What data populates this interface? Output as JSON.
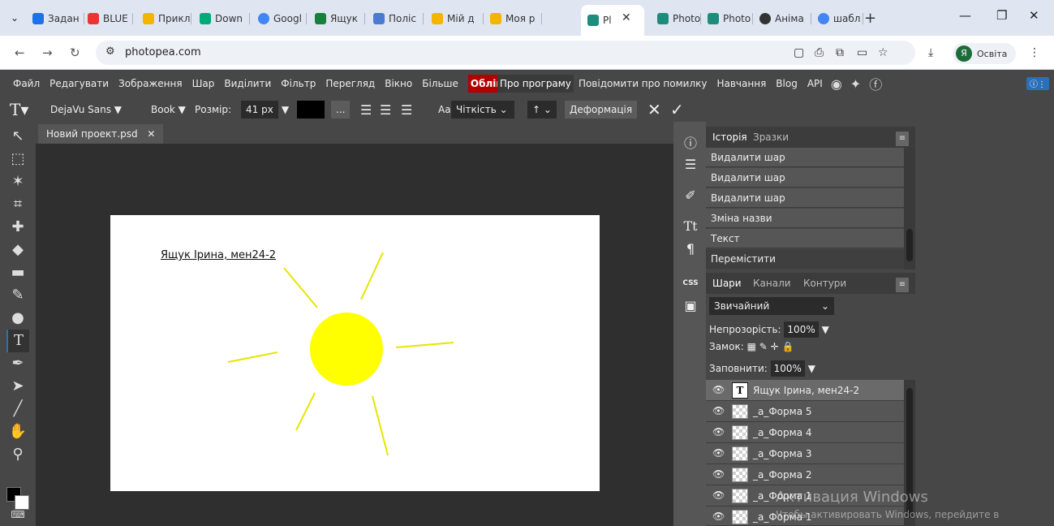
{
  "browser": {
    "tabs": [
      {
        "label": "Задан",
        "color": "#1a73e8"
      },
      {
        "label": "BLUE",
        "color": "#e33"
      },
      {
        "label": "Прикл",
        "color": "#f4b400"
      },
      {
        "label": "Down",
        "color": "#0a7"
      },
      {
        "label": "Googl",
        "color": "#4285f4"
      },
      {
        "label": "Ящук",
        "color": "#188038"
      },
      {
        "label": "Поліс",
        "color": "#4a7bd0"
      },
      {
        "label": "Мій д",
        "color": "#f4b400"
      },
      {
        "label": "Моя р",
        "color": "#f4b400"
      },
      {
        "label": "Pl",
        "color": "#1c8c7c"
      },
      {
        "label": "Photo",
        "color": "#1c8c7c"
      },
      {
        "label": "Photo",
        "color": "#1c8c7c"
      },
      {
        "label": "Аніма",
        "color": "#333"
      },
      {
        "label": "шабл",
        "color": "#4285f4"
      }
    ],
    "url": "photopea.com",
    "profile": "Освіта",
    "avatar_letter": "Я"
  },
  "menu": {
    "items": [
      "Файл",
      "Редагувати",
      "Зображення",
      "Шар",
      "Виділити",
      "Фільтр",
      "Перегляд",
      "Вікно",
      "Більше"
    ],
    "account": "Облік",
    "about": "Про програму",
    "extra": [
      "Повідомити про помилку",
      "Навчання",
      "Blog",
      "API"
    ]
  },
  "options": {
    "font": "DejaVu Sans ▼",
    "style": "Book ▼",
    "size_label": "Розмір:",
    "size_value": "41 px",
    "aa_label": "Aa:",
    "aa_value": "Чіткість",
    "direction": "↑",
    "warp": "Деформація",
    "more": "..."
  },
  "document": {
    "tab": "Новий проект.psd",
    "text": "Ящук Ірина, мен24-2"
  },
  "history": {
    "tabs": [
      "Історія",
      "Зразки"
    ],
    "items": [
      "Видалити шар",
      "Видалити шар",
      "Видалити шар",
      "Зміна назви",
      "Текст",
      "Перемістити"
    ]
  },
  "layers": {
    "tabs": [
      "Шари",
      "Канали",
      "Контури"
    ],
    "blend": "Звичайний",
    "opacity_label": "Непрозорість:",
    "opacity": "100%",
    "lock_label": "Замок:",
    "fill_label": "Заповнити:",
    "fill": "100%",
    "items": [
      "Ящук Ірина, мен24-2",
      "_а_Форма 5",
      "_а_Форма 4",
      "_а_Форма 3",
      "_а_Форма 2",
      "_а_Форма 1",
      "_а_Форма 1"
    ]
  },
  "watermark": {
    "line1": "Активация Windows",
    "line2": "Чтобы активировать Windows, перейдите в"
  }
}
